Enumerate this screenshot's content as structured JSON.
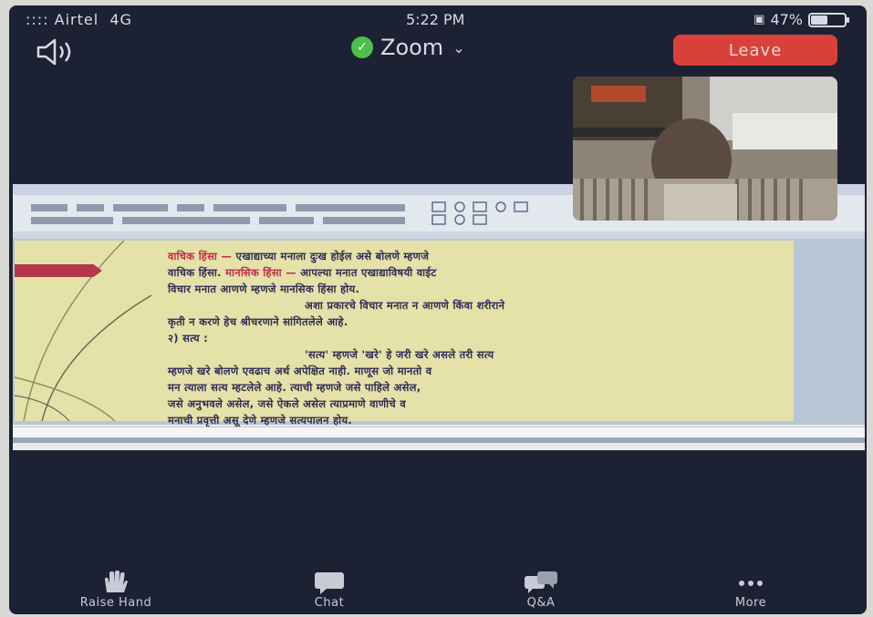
{
  "status_bar": {
    "carrier": "Airtel",
    "network": "4G",
    "time": "5:22 PM",
    "battery": "47%",
    "battery_level": 0.47
  },
  "meeting": {
    "title": "Zoom",
    "leave_label": "Leave"
  },
  "slide": {
    "line1_term": "वाचिक हिंसा —",
    "line1_rest": " एखाद्याच्या मनाला दुःख होईल असे बोलणे म्हणजे",
    "line2_a": "वाचिक हिंसा. ",
    "line2_term": "मानसिक हिंसा —",
    "line2_rest": " आपल्या मनात एखाद्याविषयी वाईट",
    "line3": "विचार मनात आणणे म्हणजे मानसिक हिंसा होय.",
    "line4": "अशा प्रकारचे विचार मनात न आणणे किंवा शरीराने",
    "line5": "कृती न करणे हेच श्रीचरणाने सांगितलेले आहे.",
    "heading": "२) सत्य :",
    "line7": "'सत्य' म्हणजे 'खरे' हे जरी खरे असले तरी सत्य",
    "line8": "म्हणजे खरे बोलणे एवढाच अर्थ अपेक्षित नाही. माणूस जो मानतो व",
    "line9": "मन त्याला सत्य म्हटलेले आहे. त्याची म्हणजे जसे पाहिले असेल,",
    "line10": "जसे अनुभवले असेल, जसे ऐकले असेल त्याप्रमाणे वाणीचे व",
    "line11": "मनाची प्रवृत्ती असू देणे म्हणजे सत्यपालन होय."
  },
  "toolbar": {
    "raise_hand": "Raise Hand",
    "chat": "Chat",
    "qa": "Q&A",
    "more": "More"
  },
  "colors": {
    "leave": "#d9403a",
    "secure_shield": "#4cc04a",
    "slide_background": "#e4e2a8",
    "slide_text": "#2e2a55",
    "slide_highlight": "#c2294a"
  }
}
